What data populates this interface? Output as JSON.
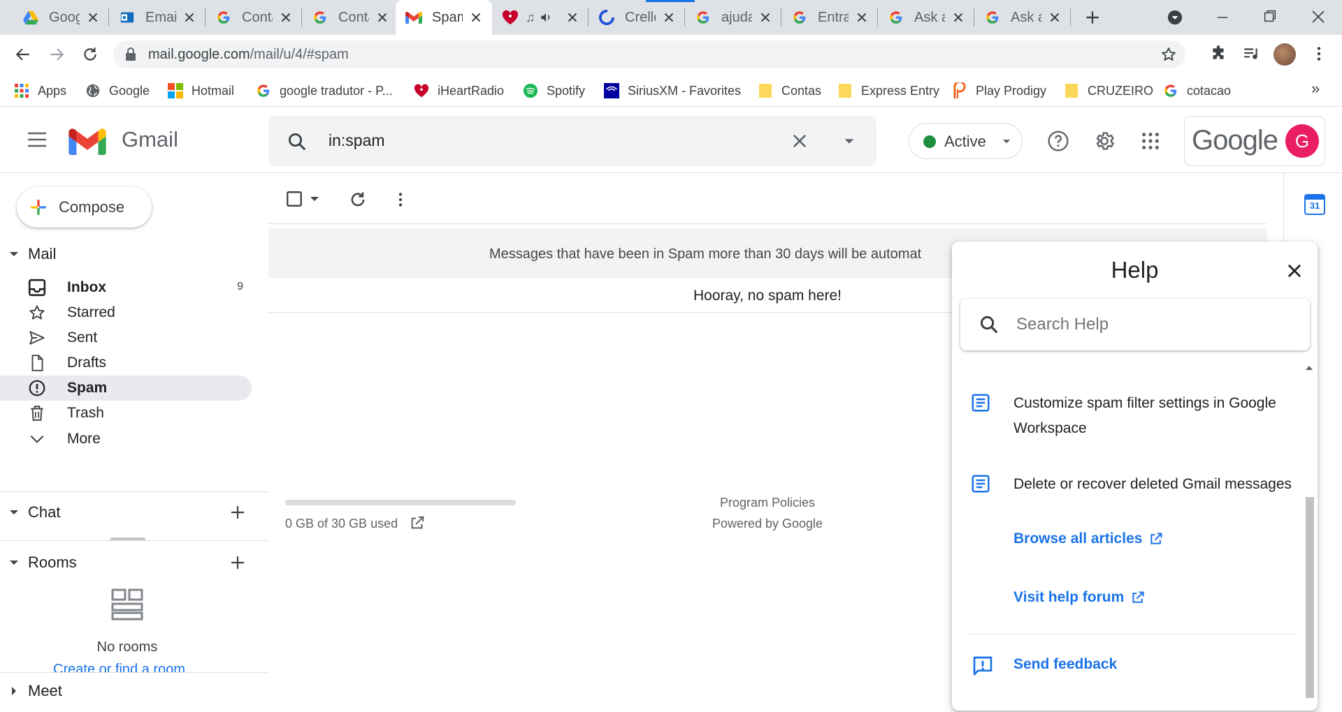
{
  "browser": {
    "tabs": [
      {
        "title": "Google",
        "icon": "google-drive-icon"
      },
      {
        "title": "Email",
        "icon": "outlook-icon"
      },
      {
        "title": "Contas",
        "icon": "google-g-icon"
      },
      {
        "title": "Contas",
        "icon": "google-g-icon"
      },
      {
        "title": "Spam",
        "icon": "gmail-icon",
        "active": true
      },
      {
        "title": "",
        "icon": "iheartradio-icon"
      },
      {
        "title": "Crello",
        "icon": "crello-icon"
      },
      {
        "title": "ajuda",
        "icon": "google-g-icon"
      },
      {
        "title": "Entrar",
        "icon": "google-g-icon"
      },
      {
        "title": "Ask a",
        "icon": "google-g-icon"
      },
      {
        "title": "Ask a",
        "icon": "google-g-icon"
      }
    ],
    "url_host": "mail.google.com",
    "url_path": "/mail/u/4/#spam",
    "bookmarks": [
      {
        "label": "Apps",
        "icon": "apps-grid-icon"
      },
      {
        "label": "Google",
        "icon": "globe-icon"
      },
      {
        "label": "Hotmail",
        "icon": "windows-icon"
      },
      {
        "label": "google tradutor - P...",
        "icon": "google-g-icon"
      },
      {
        "label": "iHeartRadio",
        "icon": "iheartradio-icon"
      },
      {
        "label": "Spotify",
        "icon": "spotify-icon"
      },
      {
        "label": "SiriusXM - Favorites",
        "icon": "siriusxm-icon"
      },
      {
        "label": "Contas",
        "icon": "folder-icon"
      },
      {
        "label": "Express Entry",
        "icon": "folder-icon"
      },
      {
        "label": "Play Prodigy",
        "icon": "prodigy-icon"
      },
      {
        "label": "CRUZEIRO",
        "icon": "folder-icon"
      },
      {
        "label": "cotacao",
        "icon": "google-g-icon"
      }
    ],
    "more_bookmarks": "»"
  },
  "gmail": {
    "logo_text": "Gmail",
    "search_value": "in:spam",
    "status_label": "Active",
    "account_brand": "Google",
    "avatar_letter": "G",
    "compose_label": "Compose",
    "sections": {
      "mail": "Mail",
      "chat": "Chat",
      "rooms": "Rooms",
      "meet": "Meet"
    },
    "nav": [
      {
        "label": "Inbox",
        "count": "9",
        "icon": "inbox-icon"
      },
      {
        "label": "Starred",
        "icon": "star-icon"
      },
      {
        "label": "Sent",
        "icon": "send-icon"
      },
      {
        "label": "Drafts",
        "icon": "draft-icon"
      },
      {
        "label": "Spam",
        "icon": "spam-icon",
        "selected": true
      },
      {
        "label": "Trash",
        "icon": "trash-icon"
      },
      {
        "label": "More",
        "icon": "chevron-down-icon"
      }
    ],
    "rooms_empty": "No rooms",
    "rooms_link": "Create or find a room",
    "notice": "Messages that have been in Spam more than 30 days will be automat",
    "empty_message": "Hooray, no spam here!",
    "storage_text": "0 GB of 30 GB used",
    "storage_fraction": 0.0,
    "footer_policies": "Program Policies",
    "footer_powered": "Powered by Google",
    "calendar_day": "31"
  },
  "help": {
    "title": "Help",
    "search_placeholder": "Search Help",
    "articles": [
      {
        "line1": "Customize spam filter settings in Google",
        "line2": "Workspace"
      },
      {
        "line1": "Delete or recover deleted Gmail messages"
      }
    ],
    "browse_all": "Browse all articles",
    "help_forum": "Visit help forum",
    "feedback": "Send feedback"
  },
  "colors": {
    "accent_blue": "#1a73e8",
    "active_green": "#1e8e3e",
    "avatar_pink": "#e91e63",
    "selected_nav_bg": "#e8eaed"
  }
}
